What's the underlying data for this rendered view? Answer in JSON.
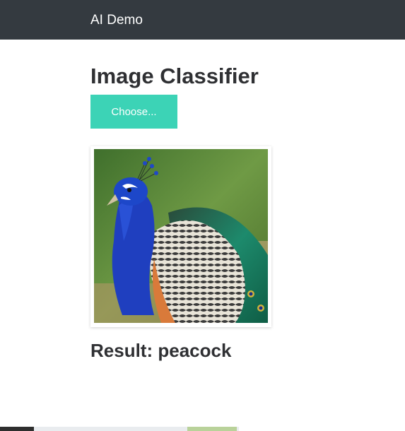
{
  "navbar": {
    "brand": "AI Demo"
  },
  "main": {
    "title": "Image Classifier",
    "choose_button_label": "Choose...",
    "result_prefix": "Result:",
    "result_value": "peacock"
  },
  "image": {
    "subject": "peacock"
  },
  "colors": {
    "navbar_bg": "#343a40",
    "button_bg": "#3cd3b6",
    "text": "#2f3033"
  }
}
